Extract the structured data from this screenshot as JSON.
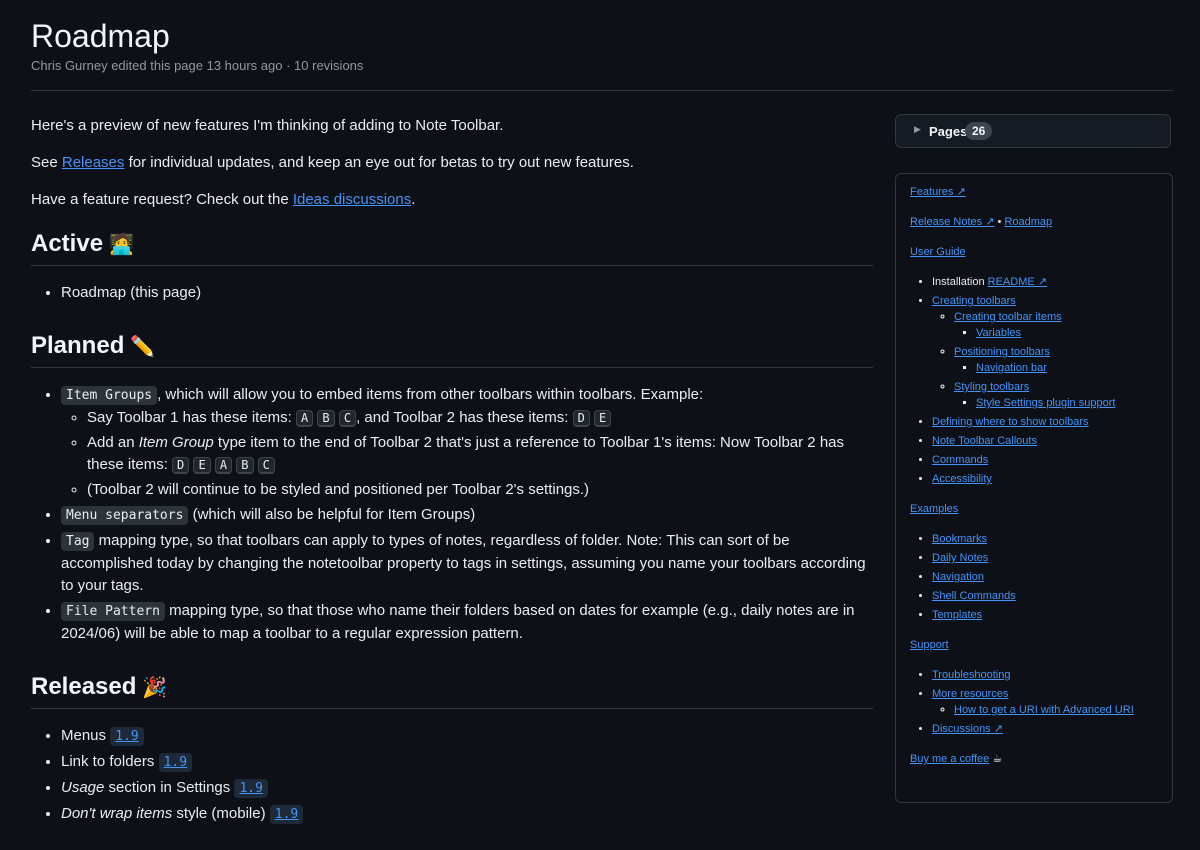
{
  "header": {
    "title": "Roadmap",
    "meta": "Chris Gurney edited this page 13 hours ago · 10 revisions"
  },
  "intro": {
    "p1": "Here's a preview of new features I'm thinking of adding to Note Toolbar.",
    "p2_pre": "See ",
    "p2_link": "Releases",
    "p2_post": " for individual updates, and keep an eye out for betas to try out new features.",
    "p3_pre": "Have a feature request? Check out the ",
    "p3_link": "Ideas discussions",
    "p3_post": "."
  },
  "active": {
    "heading": "Active",
    "emoji": "🧑‍💻",
    "items": [
      "Roadmap (this page)"
    ]
  },
  "planned": {
    "heading": "Planned",
    "emoji": "✏️",
    "item1_code": "Item Groups",
    "item1_text": ", which will allow you to embed items from other toolbars within toolbars. Example:",
    "sub1_pre": "Say Toolbar 1 has these items: ",
    "sub1_keys_a": [
      "A",
      "B",
      "C"
    ],
    "sub1_mid": ", and Toolbar 2 has these items: ",
    "sub1_keys_b": [
      "D",
      "E"
    ],
    "sub2_pre": "Add an ",
    "sub2_em": "Item Group",
    "sub2_post": " type item to the end of Toolbar 2 that's just a reference to Toolbar 1's items: Now Toolbar 2 has these items: ",
    "sub2_keys": [
      "D",
      "E",
      "A",
      "B",
      "C"
    ],
    "sub3": "(Toolbar 2 will continue to be styled and positioned per Toolbar 2's settings.)",
    "item2_code": "Menu separators",
    "item2_text": " (which will also be helpful for Item Groups)",
    "item3_code": "Tag",
    "item3_text": " mapping type, so that toolbars can apply to types of notes, regardless of folder. Note: This can sort of be accomplished today by changing the notetoolbar property to tags in settings, assuming you name your toolbars according to your tags.",
    "item4_code": "File Pattern",
    "item4_text": " mapping type, so that those who name their folders based on dates for example (e.g., daily notes are in 2024/06) will be able to map a toolbar to a regular expression pattern."
  },
  "released": {
    "heading": "Released",
    "emoji": "🎉",
    "items": [
      {
        "pre": "",
        "em": "",
        "post": "Menus ",
        "ver": "1.9"
      },
      {
        "pre": "",
        "em": "",
        "post": "Link to folders ",
        "ver": "1.9"
      },
      {
        "pre": "",
        "em": "Usage",
        "post": " section in Settings ",
        "ver": "1.9"
      },
      {
        "pre": "",
        "em": "Don't wrap items",
        "post": " style (mobile) ",
        "ver": "1.9"
      }
    ]
  },
  "pages": {
    "label": "Pages",
    "count": "26"
  },
  "sidebar": {
    "features": "Features ↗",
    "release_notes": "Release Notes ↗",
    "bullet_sep": " • ",
    "roadmap": "Roadmap",
    "user_guide": "User Guide",
    "installation": "Installation ",
    "readme": "README ↗",
    "creating_toolbars": "Creating toolbars",
    "creating_items": "Creating toolbar items",
    "variables": "Variables",
    "positioning": "Positioning toolbars",
    "navigation_bar": "Navigation bar",
    "styling": "Styling toolbars",
    "style_settings": "Style Settings plugin support",
    "defining": "Defining where to show toolbars",
    "callouts": "Note Toolbar Callouts",
    "commands": "Commands",
    "accessibility": "Accessibility",
    "examples": "Examples",
    "ex_items": [
      "Bookmarks",
      "Daily Notes",
      "Navigation",
      "Shell Commands",
      "Templates"
    ],
    "support": "Support",
    "troubleshooting": "Troubleshooting",
    "more_resources": "More resources",
    "uri": "How to get a URI with Advanced URI",
    "discussions": "Discussions ↗",
    "coffee": "Buy me a coffee",
    "coffee_emoji": "☕"
  }
}
